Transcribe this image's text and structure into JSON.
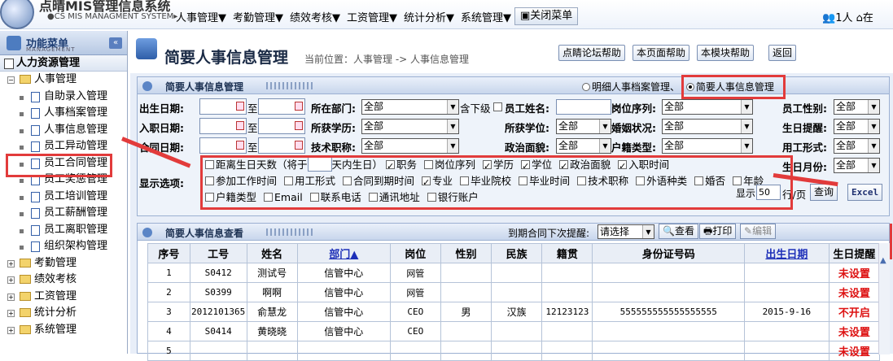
{
  "app": {
    "title": "点晴MIS管理信息系统",
    "subtitle": "CS MIS MANAGMENT SYSTEM"
  },
  "top_menu": [
    "人事管理▼",
    "考勤管理▼",
    "绩效考核▼",
    "工资管理▼",
    "统计分析▼",
    "系统管理▼"
  ],
  "close_menu": "关闭菜单",
  "top_right": {
    "online": "1人",
    "status": "在"
  },
  "sidebar": {
    "title": "功能菜单",
    "title_sub": "MANAGEMENT",
    "collapse": "«",
    "section": "人力资源管理",
    "tree": [
      {
        "label": "人事管理",
        "kind": "folder",
        "toggle": "−"
      },
      {
        "label": "自助录入管理",
        "kind": "leaf"
      },
      {
        "label": "人事档案管理",
        "kind": "leaf"
      },
      {
        "label": "人事信息管理",
        "kind": "leaf"
      },
      {
        "label": "员工异动管理",
        "kind": "leaf"
      },
      {
        "label": "员工合同管理",
        "kind": "leaf"
      },
      {
        "label": "员工奖惩管理",
        "kind": "leaf"
      },
      {
        "label": "员工培训管理",
        "kind": "leaf"
      },
      {
        "label": "员工薪酬管理",
        "kind": "leaf"
      },
      {
        "label": "员工离职管理",
        "kind": "leaf"
      },
      {
        "label": "组织架构管理",
        "kind": "leaf"
      },
      {
        "label": "考勤管理",
        "kind": "folder",
        "toggle": "+"
      },
      {
        "label": "绩效考核",
        "kind": "folder",
        "toggle": "+"
      },
      {
        "label": "工资管理",
        "kind": "folder",
        "toggle": "+"
      },
      {
        "label": "统计分析",
        "kind": "folder",
        "toggle": "+"
      },
      {
        "label": "系统管理",
        "kind": "folder",
        "toggle": "+"
      }
    ]
  },
  "header": {
    "title": "简要人事信息管理",
    "breadcrumb": "当前位置：人事管理 -> 人事信息管理",
    "buttons": [
      "点睛论坛帮助",
      "本页面帮助",
      "本模块帮助",
      "返回"
    ]
  },
  "search_panel": {
    "title": "简要人事信息管理",
    "radio_detail": "明细人事档案管理、",
    "radio_brief": "简要人事信息管理",
    "labels": {
      "birth_date": "出生日期:",
      "entry_date": "入职日期:",
      "date3": "合同日期:",
      "dept": "所在部门:",
      "edu": "所获学历:",
      "title": "技术职称:",
      "name": "员工姓名:",
      "degree": "所获学位:",
      "political": "政治面貌:",
      "position": "岗位序列:",
      "marriage": "婚姻状况:",
      "household": "户籍类型:",
      "gender": "员工性别:",
      "birthday_remind": "生日提醒:",
      "employ_form": "用工形式:",
      "birth_month": "生日月份:",
      "display_options": "显示选项:"
    },
    "to": "至",
    "include_sub": "含下级",
    "all": "全部",
    "show_prefix": "显示",
    "page_size": "50",
    "per_page": "行/页",
    "query": "查询",
    "excel": "Excel",
    "options_line1": {
      "label": "距离生日天数（将于",
      "suffix": "天内生日）"
    },
    "options": [
      {
        "label": "职务",
        "checked": true
      },
      {
        "label": "岗位序列",
        "checked": false
      },
      {
        "label": "学历",
        "checked": true
      },
      {
        "label": "学位",
        "checked": true
      },
      {
        "label": "政治面貌",
        "checked": true
      },
      {
        "label": "入职时间",
        "checked": true
      },
      {
        "label": "参加工作时间",
        "checked": false
      },
      {
        "label": "用工形式",
        "checked": false
      },
      {
        "label": "合同到期时间",
        "checked": false
      },
      {
        "label": "专业",
        "checked": true
      },
      {
        "label": "毕业院校",
        "checked": false
      },
      {
        "label": "毕业时间",
        "checked": false
      },
      {
        "label": "技术职称",
        "checked": false
      },
      {
        "label": "外语种类",
        "checked": false
      },
      {
        "label": "婚否",
        "checked": false
      },
      {
        "label": "年龄",
        "checked": false
      },
      {
        "label": "户籍类型",
        "checked": false
      },
      {
        "label": "Email",
        "checked": false
      },
      {
        "label": "联系电话",
        "checked": false
      },
      {
        "label": "通讯地址",
        "checked": false
      },
      {
        "label": "银行账户",
        "checked": false
      }
    ]
  },
  "result_panel": {
    "title": "简要人事信息查看",
    "remind_label": "到期合同下次提醒:",
    "remind_value": "请选择",
    "view": "查看",
    "print": "打印",
    "edit": "编辑",
    "columns": [
      "序号",
      "工号",
      "姓名",
      "部门▲",
      "岗位",
      "性别",
      "民族",
      "籍贯",
      "身份证号码",
      "出生日期",
      "生日提醒"
    ],
    "rows": [
      [
        "1",
        "S0412",
        "测试号",
        "信管中心",
        "网管",
        "",
        "",
        "",
        "",
        "",
        "未设置"
      ],
      [
        "2",
        "S0399",
        "啊啊",
        "信管中心",
        "网管",
        "",
        "",
        "",
        "",
        "",
        "未设置"
      ],
      [
        "3",
        "2012101365",
        "俞慧龙",
        "信管中心",
        "CEO",
        "男",
        "汉族",
        "12123123",
        "555555555555555555",
        "2015-9-16",
        "不开启"
      ],
      [
        "4",
        "S0414",
        "黄晓晓",
        "信管中心",
        "CEO",
        "",
        "",
        "",
        "",
        "",
        "未设置"
      ],
      [
        "5",
        "",
        "",
        "",
        "",
        "",
        "",
        "",
        "",
        "",
        "未设置"
      ]
    ]
  },
  "colors": {
    "highlight": "#e23b3b",
    "link": "#1d2fb8",
    "status_red": "#d11111"
  }
}
